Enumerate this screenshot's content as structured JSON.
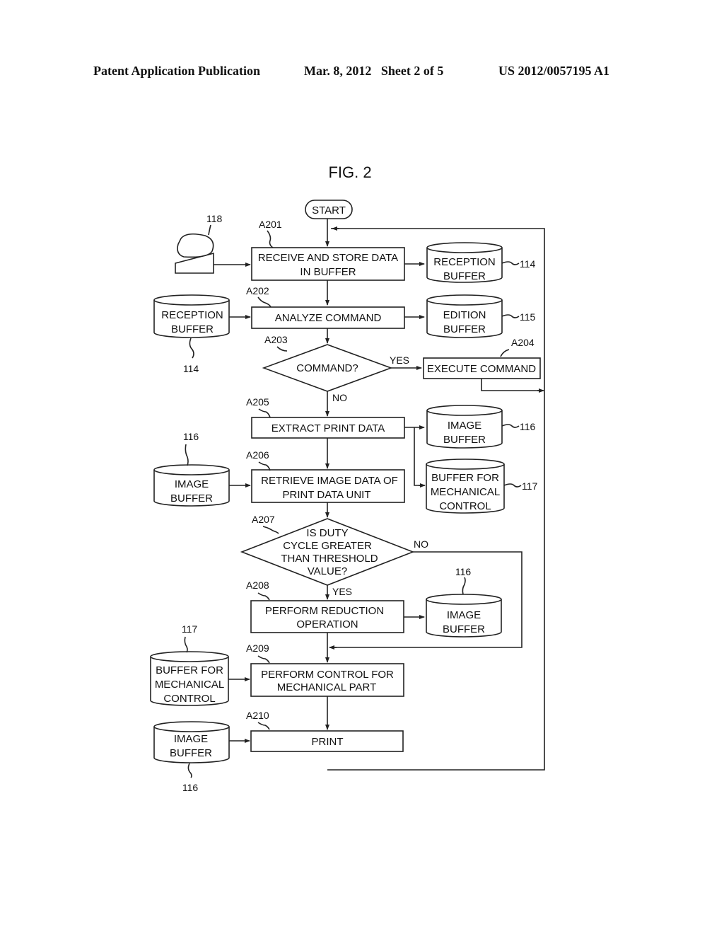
{
  "header": {
    "publication": "Patent Application Publication",
    "date_sheet": "Mar. 8, 2012   Sheet 2 of 5",
    "number": "US 2012/0057195 A1"
  },
  "figure": {
    "title": "FIG. 2",
    "start": "START",
    "steps": {
      "a201": {
        "id": "A201",
        "line1": "RECEIVE AND STORE DATA",
        "line2": "IN BUFFER"
      },
      "a202": {
        "id": "A202",
        "line1": "ANALYZE COMMAND"
      },
      "a203": {
        "id": "A203",
        "line1": "COMMAND?"
      },
      "a204": {
        "id": "A204",
        "line1": "EXECUTE COMMAND"
      },
      "a205": {
        "id": "A205",
        "line1": "EXTRACT PRINT DATA"
      },
      "a206": {
        "id": "A206",
        "line1": "RETRIEVE IMAGE DATA OF",
        "line2": "PRINT DATA UNIT"
      },
      "a207": {
        "id": "A207",
        "line1": "IS DUTY",
        "line2": "CYCLE GREATER",
        "line3": "THAN THRESHOLD",
        "line4": "VALUE?"
      },
      "a208": {
        "id": "A208",
        "line1": "PERFORM REDUCTION",
        "line2": "OPERATION"
      },
      "a209": {
        "id": "A209",
        "line1": "PERFORM CONTROL FOR",
        "line2": "MECHANICAL PART"
      },
      "a210": {
        "id": "A210",
        "line1": "PRINT"
      }
    },
    "branch_labels": {
      "yes": "YES",
      "no": "NO"
    },
    "buffers": {
      "reception_right": {
        "line1": "RECEPTION",
        "line2": "BUFFER",
        "ref": "114"
      },
      "reception_left": {
        "line1": "RECEPTION",
        "line2": "BUFFER",
        "ref": "114"
      },
      "edition_right": {
        "line1": "EDITION",
        "line2": "BUFFER",
        "ref": "115"
      },
      "image_right_a205": {
        "line1": "IMAGE",
        "line2": "BUFFER",
        "ref": "116"
      },
      "mech_right_a205": {
        "line1": "BUFFER FOR",
        "line2": "MECHANICAL",
        "line3": "CONTROL",
        "ref": "117"
      },
      "image_left_a206": {
        "line1": "IMAGE",
        "line2": "BUFFER",
        "ref": "116"
      },
      "image_right_a208": {
        "line1": "IMAGE",
        "line2": "BUFFER",
        "ref": "116"
      },
      "mech_left_a209": {
        "line1": "BUFFER FOR",
        "line2": "MECHANICAL",
        "line3": "CONTROL",
        "ref": "117"
      },
      "image_left_a210": {
        "line1": "IMAGE",
        "line2": "BUFFER",
        "ref": "116"
      }
    },
    "host": {
      "ref": "118"
    }
  }
}
